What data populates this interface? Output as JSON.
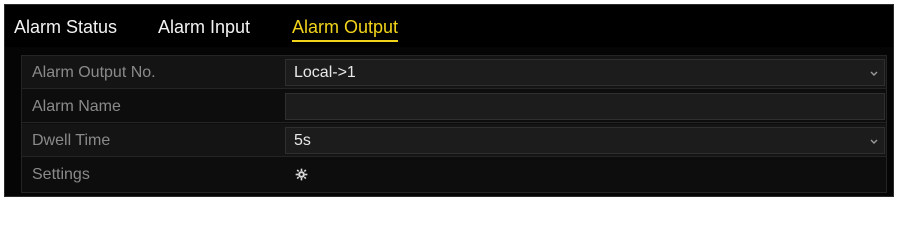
{
  "tabs": [
    {
      "label": "Alarm Status",
      "active": false
    },
    {
      "label": "Alarm Input",
      "active": false
    },
    {
      "label": "Alarm Output",
      "active": true
    }
  ],
  "form": {
    "alarm_output_no": {
      "label": "Alarm Output No.",
      "value": "Local->1"
    },
    "alarm_name": {
      "label": "Alarm Name",
      "value": ""
    },
    "dwell_time": {
      "label": "Dwell Time",
      "value": "5s"
    },
    "settings": {
      "label": "Settings",
      "icon": "gear-icon"
    }
  },
  "colors": {
    "active_tab": "#f2d31b",
    "background": "#050505",
    "label_text": "#8a8a8a",
    "value_text": "#e8e8e8"
  }
}
